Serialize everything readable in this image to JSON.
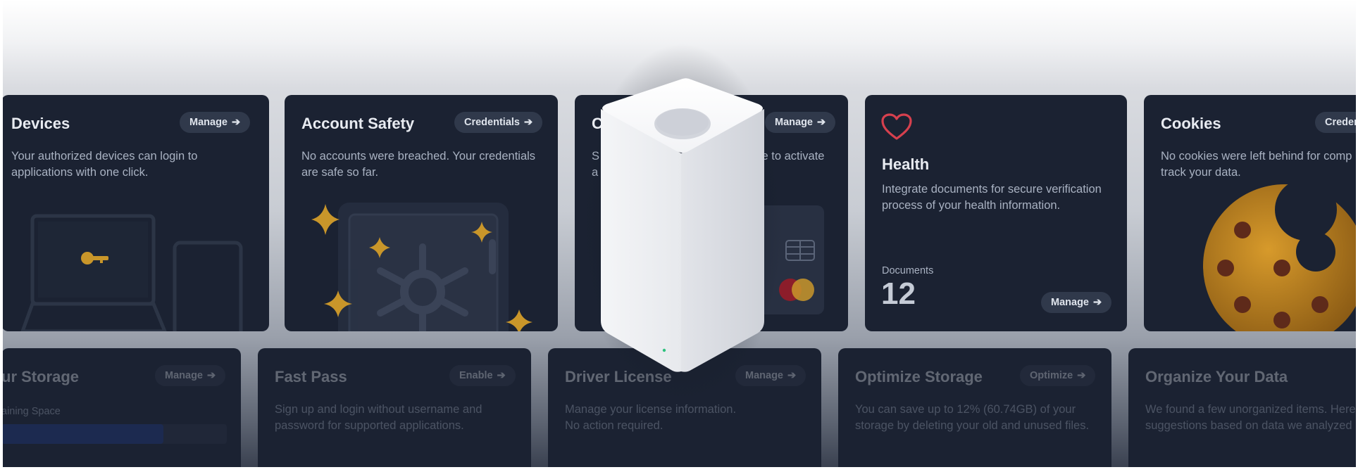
{
  "cards_row1": {
    "devices": {
      "title": "Devices",
      "button": "Manage",
      "desc": "Your authorized devices can login to\napplications with one click."
    },
    "account_safety": {
      "title": "Account Safety",
      "button": "Credentials",
      "desc": "No accounts were breached. Your credentials\nare safe so far."
    },
    "cards": {
      "title": "C",
      "button": "Manage",
      "desc_left": "S\na",
      "desc_right": "re to activate"
    },
    "health": {
      "title": "Health",
      "desc": "Integrate documents for secure verification\nprocess of your health information.",
      "documents_label": "Documents",
      "documents_count": "12",
      "button": "Manage"
    },
    "cookies": {
      "title": "Cookies",
      "button": "Creden",
      "desc": "No cookies were left behind for comp\ntrack your data."
    }
  },
  "cards_row2": {
    "storage": {
      "title": "ur Storage",
      "button": "Manage",
      "remaining_label": "aining Space"
    },
    "fast_pass": {
      "title": "Fast Pass",
      "button": "Enable",
      "desc": "Sign up and login without username and\npassword for supported applications."
    },
    "driver_license": {
      "title": "Driver License",
      "button": "Manage",
      "desc": "Manage your license information.\nNo action required."
    },
    "optimize_storage": {
      "title": "Optimize Storage",
      "button": "Optimize",
      "desc": "You can save up to 12% (60.74GB) of your\nstorage by deleting your old and unused files."
    },
    "organize_data": {
      "title": "Organize Your Data",
      "desc": "We found a few unorganized items. Here\nsuggestions based on data we analyzed"
    }
  },
  "colors": {
    "card_bg": "#1b2232",
    "pill_bg": "#30394b",
    "gold": "#c9962a",
    "heart": "#d6404e",
    "storage_bar": "#1f3a8a"
  },
  "icons": [
    "arrow-right-icon",
    "key-icon",
    "heart-icon",
    "safe-icon",
    "sparkle-icon",
    "cookie-icon",
    "mastercard-icon",
    "chip-icon",
    "laptop-icon",
    "tablet-icon"
  ],
  "storage_used_fraction": 0.72
}
